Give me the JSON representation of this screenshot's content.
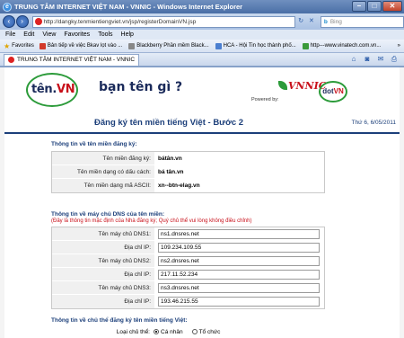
{
  "window": {
    "title": "TRUNG TÂM INTERNET VIỆT NAM - VNNIC - Windows Internet Explorer",
    "controls": {
      "minimize": "–",
      "maximize": "□",
      "close": "✕"
    }
  },
  "address": {
    "url": "http://dangky.tenmientiengviet.vn/jsp/registerDomainVN.jsp",
    "search_placeholder": "Bing",
    "search_brand": "b"
  },
  "menu": [
    "File",
    "Edit",
    "View",
    "Favorites",
    "Tools",
    "Help"
  ],
  "favorites": {
    "label": "Favorites",
    "items": [
      "Bản tiếp về việc Bkav lọt vào ...",
      "Blackberry Phần mềm Black...",
      "HCA - Hội Tin học thành phố...",
      "http---www.vinatech.com.vn..."
    ],
    "more": "»"
  },
  "tab": {
    "label": "TRUNG TÂM INTERNET VIỆT NAM - VNNIC"
  },
  "site": {
    "logo_ten": "tên.",
    "logo_vn": "VN",
    "slogan": "bạn tên gì ?",
    "powered_by": "Powered by:",
    "vnnic": "VNNIC",
    "dotvn_dot": "dot",
    "dotvn_vn": "VN"
  },
  "page": {
    "title": "Đăng ký tên miền tiếng Việt - Bước 2",
    "date": "Thứ 6, 6/05/2011"
  },
  "domain_section": {
    "heading": "Thông tin về tên miền đăng ký:",
    "rows": [
      {
        "label": "Tên miền đăng ký:",
        "value": "bátân.vn"
      },
      {
        "label": "Tên miền dạng có dấu cách:",
        "value": "bá tân.vn"
      },
      {
        "label": "Tên miền dạng mã ASCII:",
        "value": "xn--btn-elag.vn"
      }
    ]
  },
  "dns_section": {
    "heading": "Thông tin về máy chủ DNS của tên miền:",
    "note": "(Đây là thông tin mặc định của Nhà đăng ký; Quý chủ thể vui lòng không điều chỉnh)",
    "rows": [
      {
        "label": "Tên máy chủ DNS1:",
        "value": "ns1.dnsres.net"
      },
      {
        "label": "Địa chỉ IP:",
        "value": "109.234.109.55"
      },
      {
        "label": "Tên máy chủ DNS2:",
        "value": "ns2.dnsres.net"
      },
      {
        "label": "Địa chỉ IP:",
        "value": "217.11.52.234"
      },
      {
        "label": "Tên máy chủ DNS3:",
        "value": "ns3.dnsres.net"
      },
      {
        "label": "Địa chỉ IP:",
        "value": "193.46.215.55"
      }
    ]
  },
  "owner_section": {
    "heading": "Thông tin về chủ thể đăng ký tên miền tiếng Việt:",
    "type_label": "Loại chủ thể:",
    "options": [
      "Cá nhân",
      "Tổ chức"
    ]
  }
}
